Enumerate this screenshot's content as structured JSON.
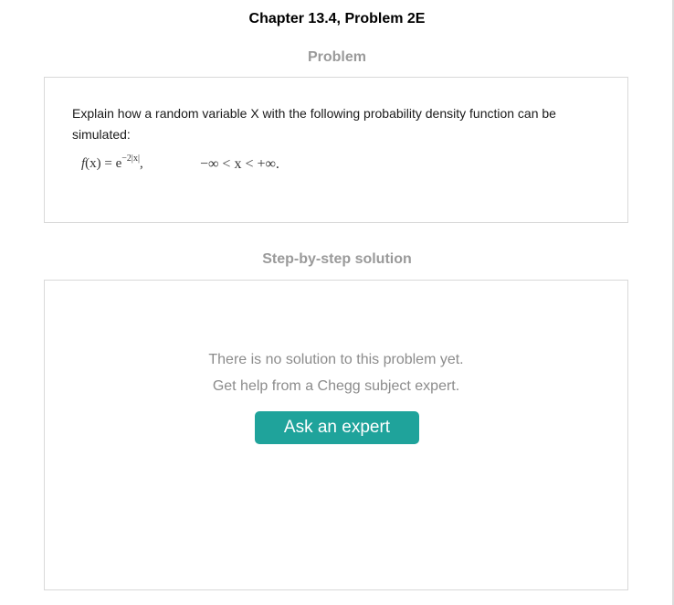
{
  "header": {
    "chapter_title": "Chapter 13.4, Problem 2E"
  },
  "problem": {
    "heading": "Problem",
    "text": "Explain how a random variable X with the following probability density function can be simulated:",
    "formula": {
      "lhs_fn": "f",
      "lhs_arg": "(x)",
      "equals": " = e",
      "exponent": "−2|x|",
      "comma": ",",
      "range": "−∞ < x < +∞."
    }
  },
  "solution": {
    "heading": "Step-by-step solution",
    "empty_message": "There is no solution to this problem yet.",
    "help_message": "Get help from a Chegg subject expert.",
    "ask_button_label": "Ask an expert"
  },
  "colors": {
    "accent_button": "#1fa39b",
    "heading_gray": "#9a9a9a",
    "border_gray": "#d9d9d9"
  }
}
